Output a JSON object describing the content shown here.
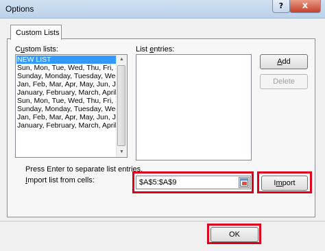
{
  "window": {
    "title": "Options",
    "help_label": "?",
    "close_label": "x"
  },
  "tabs": [
    {
      "label": "Custom Lists"
    }
  ],
  "custom_lists": {
    "label_pre": "C",
    "label_ul": "u",
    "label_post": "stom lists:",
    "items": [
      "NEW LIST",
      "Sun, Mon, Tue, Wed, Thu, Fri, S",
      "Sunday, Monday, Tuesday, Wed",
      "Jan, Feb, Mar, Apr, May, Jun, J",
      "January, February, March, April",
      "Sun, Mon, Tue, Wed, Thu, Fri, S",
      "Sunday, Monday, Tuesday, Wed",
      "Jan, Feb, Mar, Apr, May, Jun, J",
      "January, February, March, April"
    ],
    "selected_index": 0
  },
  "list_entries": {
    "label_pre": "List ",
    "label_ul": "e",
    "label_post": "ntries:"
  },
  "buttons": {
    "add_pre": "",
    "add_ul": "A",
    "add_post": "dd",
    "delete": "Delete",
    "import_pre": "I",
    "import_ul": "m",
    "import_post": "port",
    "ok": "OK"
  },
  "hint": "Press Enter to separate list entries.",
  "import_from": {
    "label_pre": "",
    "label_ul": "I",
    "label_post": "mport list from cells:",
    "value": "$A$5:$A$9"
  },
  "colors": {
    "highlight": "#e0001b",
    "selection": "#3399ff"
  }
}
